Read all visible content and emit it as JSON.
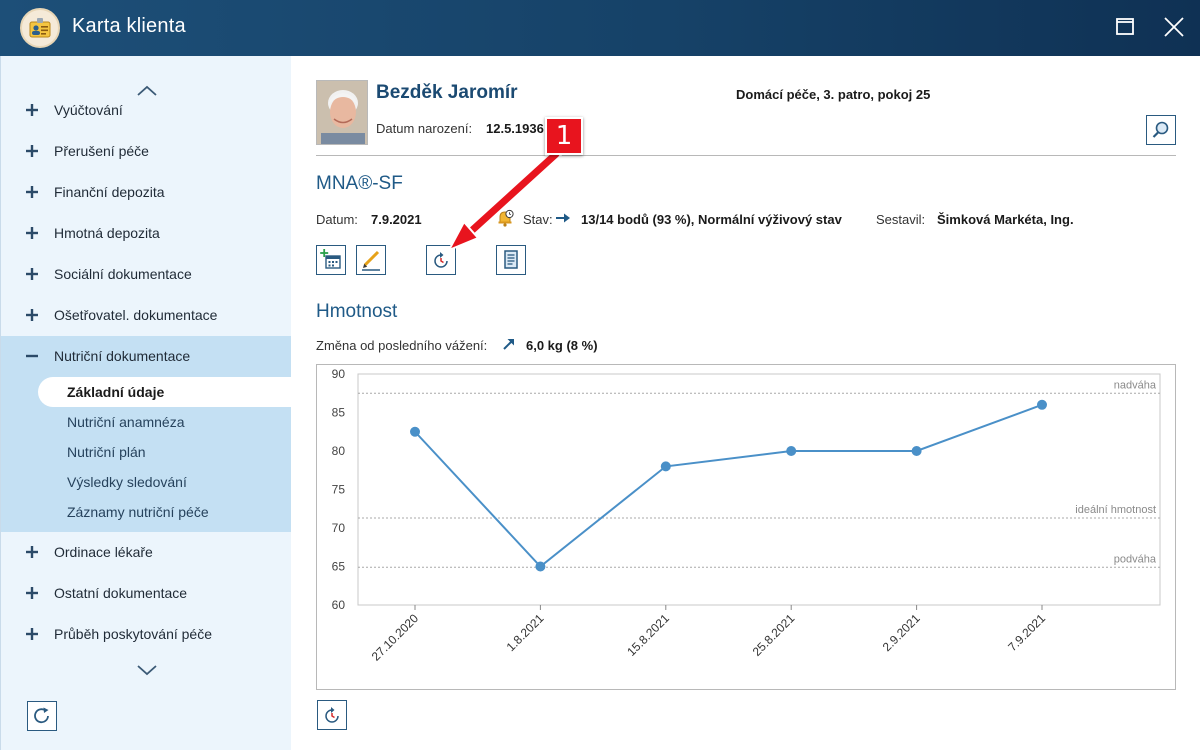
{
  "window": {
    "title": "Karta klienta",
    "maximize_icon": "maximize-icon",
    "close_icon": "close-icon"
  },
  "sidebar": {
    "items": [
      {
        "label": "Vyúčtování",
        "icon": "plus-icon"
      },
      {
        "label": "Přerušení péče",
        "icon": "plus-icon"
      },
      {
        "label": "Finanční depozita",
        "icon": "plus-icon"
      },
      {
        "label": "Hmotná depozita",
        "icon": "plus-icon"
      },
      {
        "label": "Sociální dokumentace",
        "icon": "plus-icon"
      },
      {
        "label": "Ošetřovatel. dokumentace",
        "icon": "plus-icon"
      },
      {
        "label": "Nutriční dokumentace",
        "icon": "minus-icon"
      },
      {
        "label": "Ordinace lékaře",
        "icon": "plus-icon"
      },
      {
        "label": "Ostatní dokumentace",
        "icon": "plus-icon"
      },
      {
        "label": "Průběh poskytování péče",
        "icon": "plus-icon"
      }
    ],
    "subitems": [
      {
        "label": "Základní údaje",
        "selected": true
      },
      {
        "label": "Nutriční anamnéza",
        "selected": false
      },
      {
        "label": "Nutriční plán",
        "selected": false
      },
      {
        "label": "Výsledky sledování",
        "selected": false
      },
      {
        "label": "Záznamy nutriční péče",
        "selected": false
      }
    ]
  },
  "patient": {
    "name": "Bezděk Jaromír",
    "dob_label": "Datum narození:",
    "dob_value": "12.5.1936",
    "location": "Domácí péče, 3. patro, pokoj 25"
  },
  "mna": {
    "title": "MNA®-SF",
    "date_label": "Datum:",
    "date_value": "7.9.2021",
    "status_label": "Stav:",
    "status_value": "13/14 bodů (93 %), Normální výživový stav",
    "author_label": "Sestavil:",
    "author_value": "Šimková Markéta, Ing.",
    "tools": [
      "add-calendar-icon",
      "edit-pencil-icon",
      "history-clock-icon",
      "document-icon"
    ]
  },
  "weight": {
    "title": "Hmotnost",
    "change_label": "Změna od posledního vážení:",
    "change_value": "6,0 kg (8 %)"
  },
  "callout": {
    "number": "1"
  },
  "colors": {
    "accent": "#1f5a87",
    "titlebar": "#164268",
    "series": "#4a90c8",
    "callout": "#e8141e",
    "sidebar_active": "#c4e0f3"
  },
  "chart_data": {
    "type": "line",
    "categories": [
      "27.10.2020",
      "1.8.2021",
      "15.8.2021",
      "25.8.2021",
      "2.9.2021",
      "7.9.2021"
    ],
    "values": [
      82.5,
      65,
      78,
      80,
      80,
      86
    ],
    "ylim": [
      60,
      90
    ],
    "yticks": [
      60,
      65,
      70,
      75,
      80,
      85,
      90
    ],
    "reference_lines": [
      {
        "label": "nadváha",
        "value": 87.5
      },
      {
        "label": "ideální hmotnost",
        "value": 71.3
      },
      {
        "label": "podváha",
        "value": 64.9
      }
    ],
    "grid": false
  }
}
